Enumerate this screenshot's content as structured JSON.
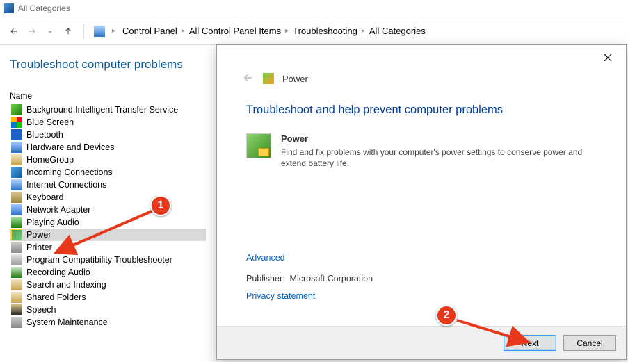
{
  "window": {
    "title": "All Categories"
  },
  "nav": {
    "crumbs": [
      "Control Panel",
      "All Control Panel Items",
      "Troubleshooting",
      "All Categories"
    ]
  },
  "left": {
    "heading": "Troubleshoot computer problems",
    "column": "Name",
    "items": [
      {
        "label": "Background Intelligent Transfer Service",
        "ico": "ico-bits"
      },
      {
        "label": "Blue Screen",
        "ico": "ico-bluescreen"
      },
      {
        "label": "Bluetooth",
        "ico": "ico-bluetooth"
      },
      {
        "label": "Hardware and Devices",
        "ico": "ico-hardware"
      },
      {
        "label": "HomeGroup",
        "ico": "ico-homegroup"
      },
      {
        "label": "Incoming Connections",
        "ico": "ico-incoming"
      },
      {
        "label": "Internet Connections",
        "ico": "ico-inet"
      },
      {
        "label": "Keyboard",
        "ico": "ico-keyboard"
      },
      {
        "label": "Network Adapter",
        "ico": "ico-netadapter"
      },
      {
        "label": "Playing Audio",
        "ico": "ico-audio"
      },
      {
        "label": "Power",
        "ico": "ico-power",
        "selected": true
      },
      {
        "label": "Printer",
        "ico": "ico-printer"
      },
      {
        "label": "Program Compatibility Troubleshooter",
        "ico": "ico-compat"
      },
      {
        "label": "Recording Audio",
        "ico": "ico-rec"
      },
      {
        "label": "Search and Indexing",
        "ico": "ico-search"
      },
      {
        "label": "Shared Folders",
        "ico": "ico-shared"
      },
      {
        "label": "Speech",
        "ico": "ico-speech"
      },
      {
        "label": "System Maintenance",
        "ico": "ico-sysmaint"
      }
    ]
  },
  "dialog": {
    "title": "Power",
    "heading": "Troubleshoot and help prevent computer problems",
    "item_name": "Power",
    "item_desc": "Find and fix problems with your computer's power settings to conserve power and extend battery life.",
    "advanced": "Advanced",
    "publisher_label": "Publisher:",
    "publisher": "Microsoft Corporation",
    "privacy": "Privacy statement",
    "next": "Next",
    "cancel": "Cancel"
  },
  "annotations": {
    "one": "1",
    "two": "2"
  }
}
